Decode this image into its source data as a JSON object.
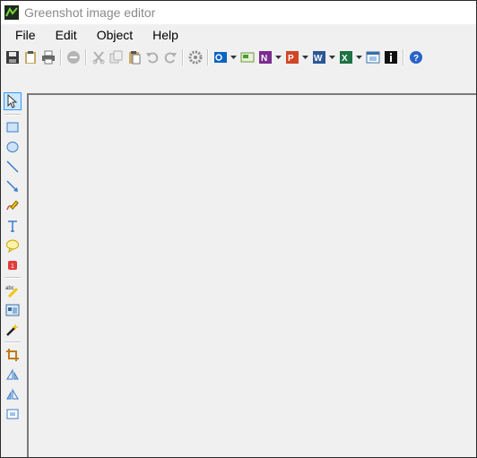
{
  "window": {
    "title": "Greenshot image editor"
  },
  "menu": {
    "file": "File",
    "edit": "Edit",
    "object": "Object",
    "help": "Help"
  },
  "toolbar_icons": [
    "save-icon",
    "clipboard-icon",
    "print-icon",
    "delete-icon",
    "cut-icon",
    "copy-icon",
    "paste-icon",
    "undo-icon",
    "redo-icon",
    "settings-icon",
    "outlook-icon",
    "email-icon",
    "onenote-icon",
    "powerpoint-icon",
    "word-icon",
    "excel-icon",
    "window-icon",
    "info-icon",
    "help-icon"
  ],
  "drawing_tools": [
    "select-icon",
    "rectangle-icon",
    "ellipse-icon",
    "line-icon",
    "arrow-icon",
    "freehand-icon",
    "text-icon",
    "speechbubble-icon",
    "counter-icon",
    "highlight-icon",
    "obfuscate-icon",
    "effects-icon",
    "crop-icon",
    "rotate-left-icon",
    "rotate-right-icon",
    "resize-icon"
  ],
  "colors": {
    "accent": "#3399ff",
    "window_bg": "#f0f0f0",
    "title_text": "#8a8a8a"
  }
}
